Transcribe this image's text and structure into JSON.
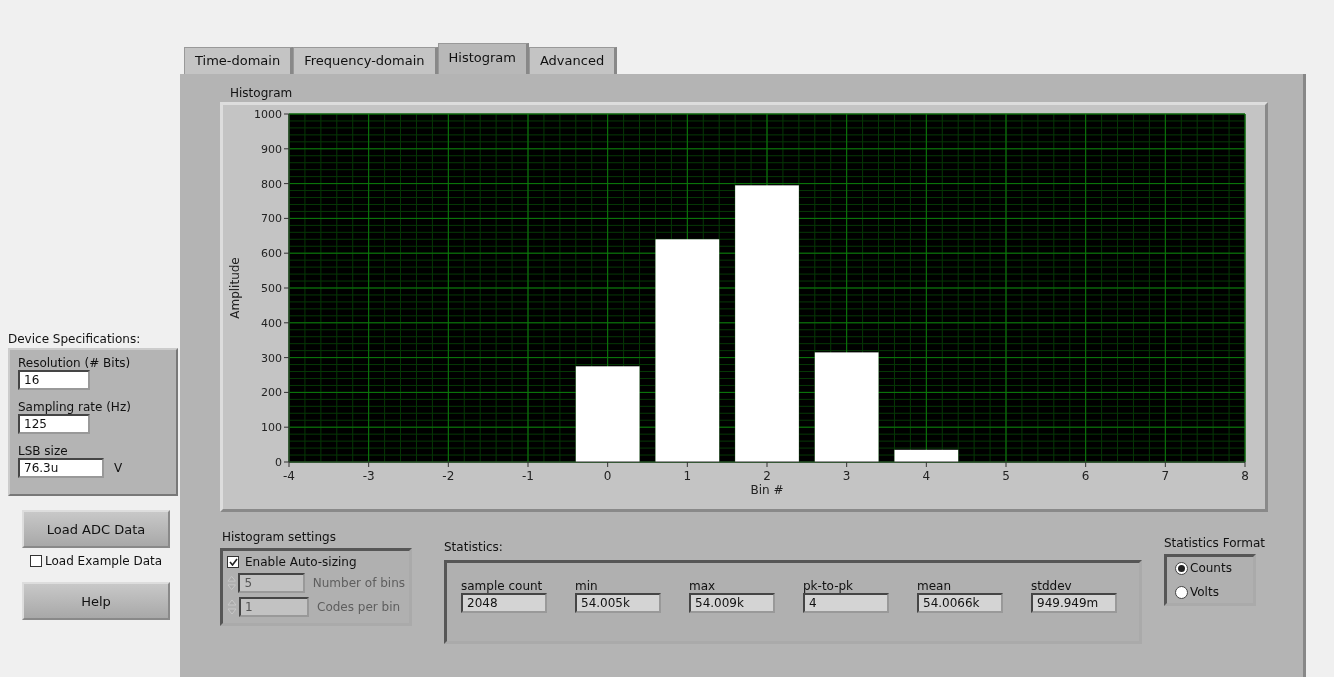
{
  "device_specs": {
    "title": "Device Specifications:",
    "fields": [
      {
        "label": "Resolution (# Bits)",
        "value": "16"
      },
      {
        "label": "Sampling rate (Hz)",
        "value": "125"
      },
      {
        "label": "LSB size",
        "value": "76.3u",
        "unit": "V"
      }
    ]
  },
  "load_button": "Load ADC Data",
  "example_checkbox": {
    "label": "Load Example Data",
    "checked": false
  },
  "help_button": "Help",
  "tabs": [
    {
      "label": "Time-domain",
      "selected": false
    },
    {
      "label": "Frequency-domain",
      "selected": false
    },
    {
      "label": "Histogram",
      "selected": true
    },
    {
      "label": "Advanced",
      "selected": false
    }
  ],
  "histogram": {
    "chart_data": {
      "type": "bar",
      "grid": true,
      "title": "Histogram",
      "xlabel": "Bin #",
      "ylabel": "Amplitude",
      "x": [
        0,
        1,
        2,
        3,
        4
      ],
      "values": [
        275,
        640,
        795,
        315,
        35
      ],
      "xlim": [
        -4,
        8
      ],
      "ylim": [
        0,
        1000
      ],
      "xticks": [
        -4,
        -3,
        -2,
        -1,
        0,
        1,
        2,
        3,
        4,
        5,
        6,
        7,
        8
      ],
      "yticks": [
        0,
        100,
        200,
        300,
        400,
        500,
        600,
        700,
        800,
        900,
        1000
      ]
    }
  },
  "histogram_settings": {
    "title": "Histogram settings",
    "auto_sizing": {
      "label": "Enable Auto-sizing",
      "checked": true
    },
    "fields": [
      {
        "label": "Number of bins",
        "value": "5",
        "disabled": true
      },
      {
        "label": "Codes per bin",
        "value": "1",
        "disabled": true
      }
    ]
  },
  "statistics": {
    "title": "Statistics:",
    "fields": [
      {
        "label": "sample count",
        "value": "2048"
      },
      {
        "label": "min",
        "value": "54.005k"
      },
      {
        "label": "max",
        "value": "54.009k"
      },
      {
        "label": "pk-to-pk",
        "value": "4"
      },
      {
        "label": "mean",
        "value": "54.0066k"
      },
      {
        "label": "stddev",
        "value": "949.949m"
      }
    ]
  },
  "statistics_format": {
    "title": "Statistics Format",
    "options": [
      {
        "label": "Counts",
        "selected": true
      },
      {
        "label": "Volts",
        "selected": false
      }
    ]
  }
}
